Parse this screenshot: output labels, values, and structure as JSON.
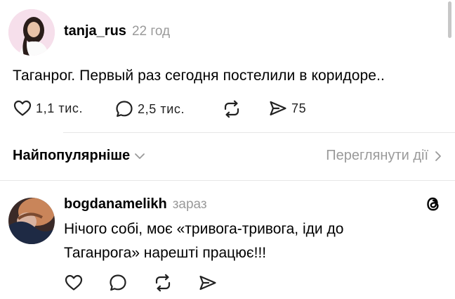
{
  "post": {
    "username": "tanja_rus",
    "time": "22 год",
    "text": "Таганрог. Первый раз сегодня постелили в коридоре..",
    "likes": "1,1 тис.",
    "replies": "2,5 тис.",
    "shares": "75"
  },
  "sort": {
    "label": "Найпопулярніше",
    "view_activity": "Переглянути дії"
  },
  "reply": {
    "username": "bogdanamelikh",
    "time": "зараз",
    "text_line1": "Нічого собі, моє «тривога-тривога, іди до",
    "text_line2": "Таганрога» нарешті працює!!!"
  },
  "icons": {
    "like": "heart-icon",
    "comment": "comment-bubble-icon",
    "repost": "repost-icon",
    "share": "send-icon",
    "threads": "threads-logo-icon",
    "chevron": "chevron-icon"
  }
}
